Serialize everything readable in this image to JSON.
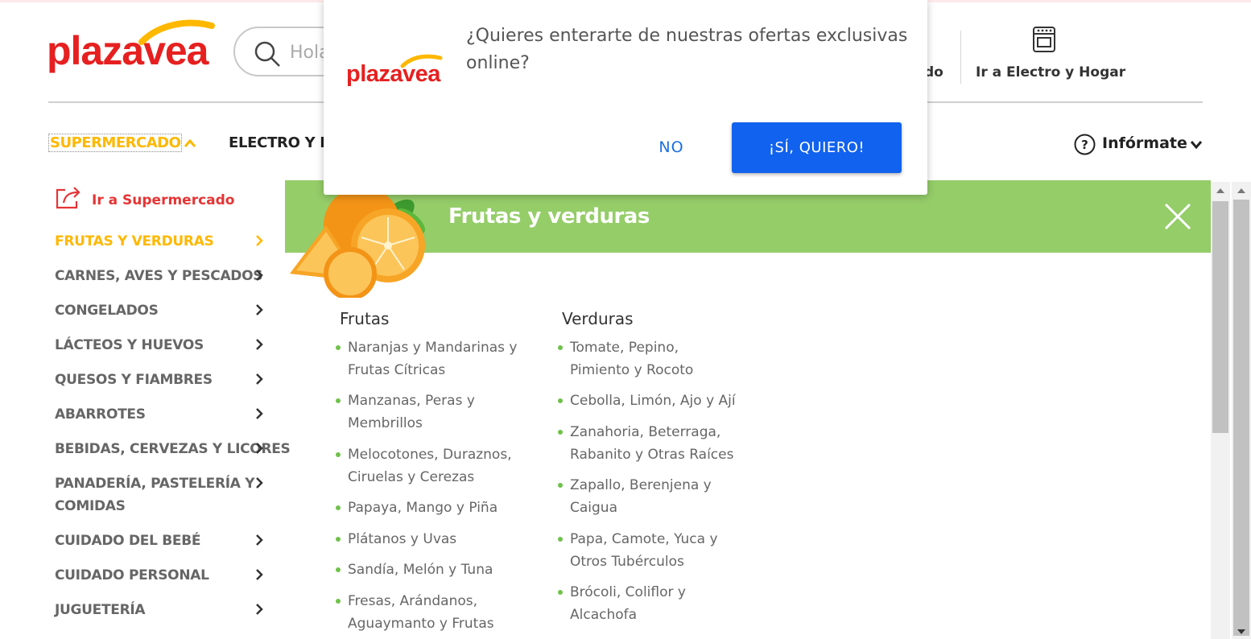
{
  "brand": {
    "logo_text_main": "plaza",
    "logo_text_accent": "vea",
    "red": "#e62020",
    "yellow": "#ffb800"
  },
  "header": {
    "search_placeholder": "Hola",
    "partial_link": "do",
    "electro_link": "Ir a Electro y Hogar",
    "electro_icon": "stove-icon"
  },
  "nav": {
    "supermercado": "SUPERMERCADO",
    "electro": "ELECTRO Y H",
    "informate": "Infórmate"
  },
  "sidebar": {
    "goto_label": "Ir a Supermercado",
    "categories": [
      "FRUTAS Y VERDURAS",
      "CARNES, AVES Y PESCADOS",
      "CONGELADOS",
      "LÁCTEOS Y HUEVOS",
      "QUESOS Y FIAMBRES",
      "ABARROTES",
      "BEBIDAS, CERVEZAS Y LICORES",
      "PANADERÍA, PASTELERÍA Y",
      "COMIDAS",
      "CUIDADO DEL BEBÉ",
      "CUIDADO PERSONAL",
      "JUGUETERÍA"
    ]
  },
  "panel": {
    "title": "Frutas y verduras",
    "banner_color": "#95cd69",
    "frutas": {
      "title": "Frutas",
      "items": [
        [
          "Naranjas y Mandarinas y",
          "Frutas Cítricas"
        ],
        [
          "Manzanas, Peras y",
          "Membrillos"
        ],
        [
          "Melocotones, Duraznos,",
          "Ciruelas y Cerezas"
        ],
        [
          "Papaya, Mango y Piña"
        ],
        [
          "Plátanos y Uvas"
        ],
        [
          "Sandía, Melón y Tuna"
        ],
        [
          "Fresas, Arándanos,",
          "Aguaymanto y Frutas"
        ]
      ]
    },
    "verduras": {
      "title": "Verduras",
      "items": [
        [
          "Tomate, Pepino,",
          "Pimiento y Rocoto"
        ],
        [
          "Cebolla, Limón, Ajo y Ají"
        ],
        [
          "Zanahoria, Beterraga,",
          "Rabanito y Otras Raíces"
        ],
        [
          "Zapallo, Berenjena y",
          "Caigua"
        ],
        [
          "Papa, Camote, Yuca y",
          "Otros Tubérculos"
        ],
        [
          "Brócoli, Coliflor y",
          "Alcachofa"
        ]
      ]
    }
  },
  "modal": {
    "line1": "¿Quieres enterarte de nuestras ofertas exclusivas",
    "line2": "online?",
    "no_label": "NO",
    "yes_label": "¡SÍ, QUIERO!",
    "yes_color": "#1162ee"
  }
}
